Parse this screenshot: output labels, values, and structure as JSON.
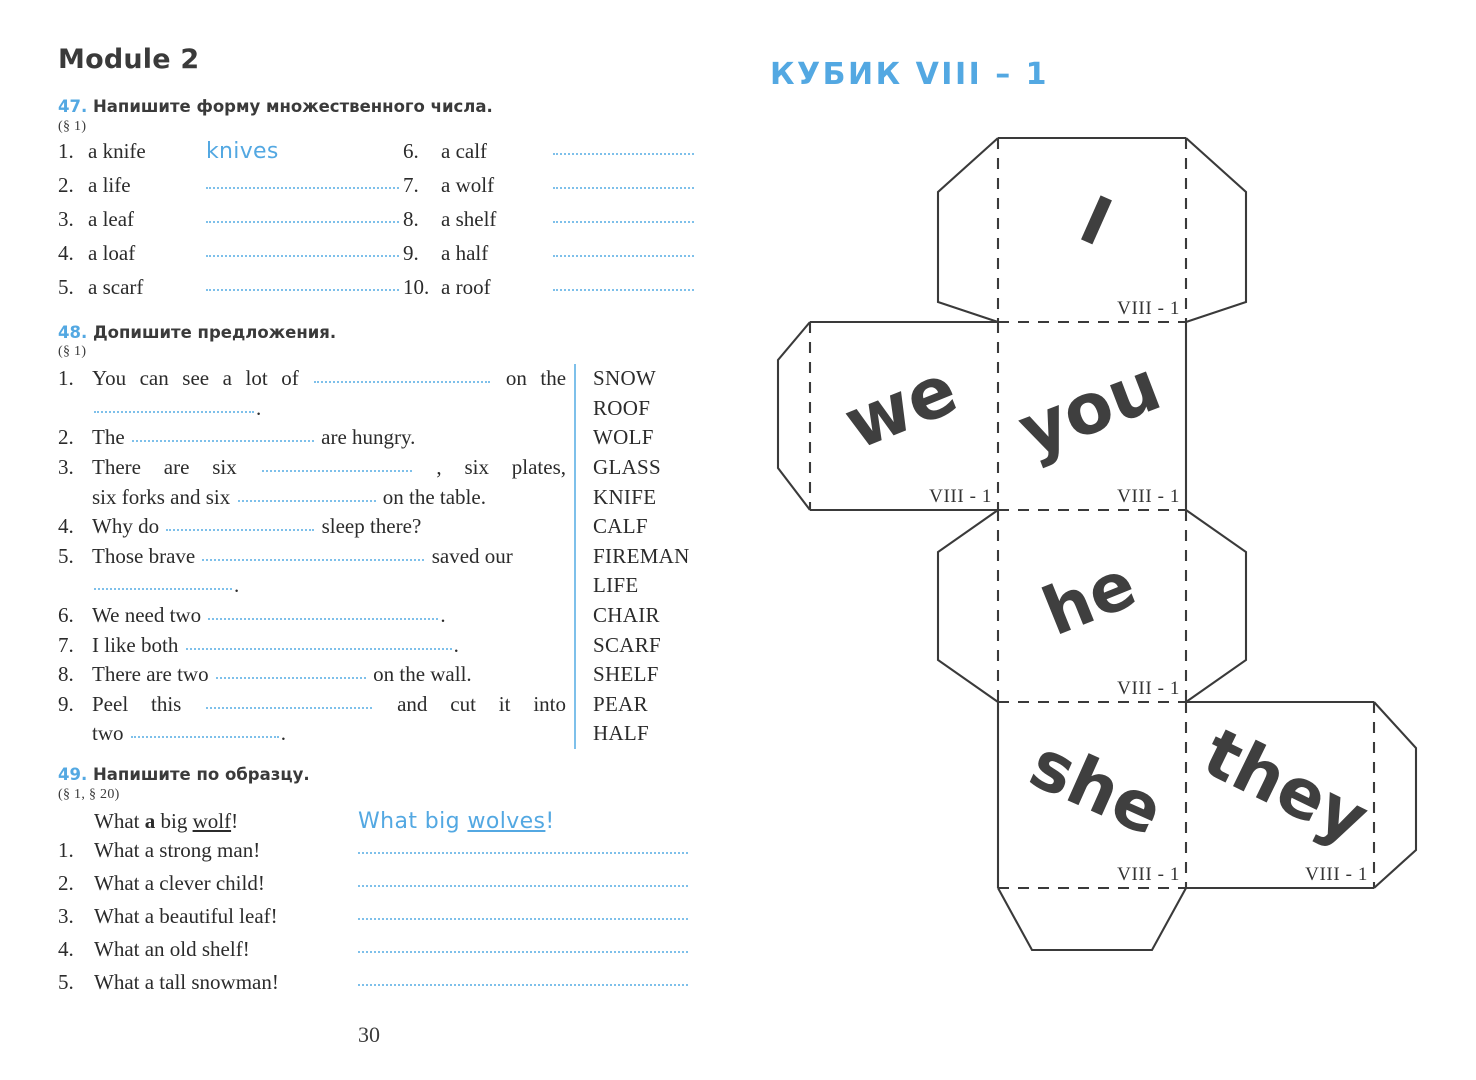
{
  "page": {
    "module_title": "Module 2",
    "page_number": "30"
  },
  "exercise47": {
    "number": "47.",
    "instruction": "Напишите форму множественного числа.",
    "reference": "(§ 1)",
    "column1": [
      {
        "index": "1.",
        "term": "a knife",
        "answer": "knives",
        "filled": true
      },
      {
        "index": "2.",
        "term": "a life",
        "answer": "",
        "filled": false
      },
      {
        "index": "3.",
        "term": "a leaf",
        "answer": "",
        "filled": false
      },
      {
        "index": "4.",
        "term": "a loaf",
        "answer": "",
        "filled": false
      },
      {
        "index": "5.",
        "term": "a scarf",
        "answer": "",
        "filled": false
      }
    ],
    "column2": [
      {
        "index": "6.",
        "term": "a calf",
        "answer": "",
        "filled": false
      },
      {
        "index": "7.",
        "term": "a wolf",
        "answer": "",
        "filled": false
      },
      {
        "index": "8.",
        "term": "a shelf",
        "answer": "",
        "filled": false
      },
      {
        "index": "9.",
        "term": "a half",
        "answer": "",
        "filled": false
      },
      {
        "index": "10.",
        "term": "a roof",
        "answer": "",
        "filled": false
      }
    ]
  },
  "exercise48": {
    "number": "48.",
    "instruction": "Допишите предложения.",
    "reference": "(§ 1)",
    "sentences": [
      {
        "index": "1.",
        "part1": "You can see a lot of",
        "part2": "on the",
        "part3": ".",
        "two_lines": true
      },
      {
        "index": "2.",
        "part1": "The",
        "part2": "are hungry.",
        "two_lines": false
      },
      {
        "index": "3.",
        "part1": "There are six",
        "part2": ", six plates,",
        "part3": "six forks and six",
        "part4": "on the table.",
        "two_lines": true
      },
      {
        "index": "4.",
        "part1": "Why do",
        "part2": "sleep there?",
        "two_lines": false
      },
      {
        "index": "5.",
        "part1": "Those brave",
        "part2": "saved our",
        "part3": ".",
        "two_lines": true
      },
      {
        "index": "6.",
        "part1": "We need two",
        "part2": ".",
        "two_lines": false
      },
      {
        "index": "7.",
        "part1": "I like both",
        "part2": ".",
        "two_lines": false
      },
      {
        "index": "8.",
        "part1": "There are two",
        "part2": "on the wall.",
        "two_lines": false
      },
      {
        "index": "9.",
        "part1": "Peel this",
        "part2": "and cut it into",
        "part3": "two",
        "part4": ".",
        "two_lines": true
      }
    ],
    "word_bank": [
      "SNOW",
      "ROOF",
      "WOLF",
      "GLASS",
      "KNIFE",
      "CALF",
      "FIREMAN",
      "LIFE",
      "CHAIR",
      "SCARF",
      "SHELF",
      "PEAR",
      "HALF"
    ]
  },
  "exercise49": {
    "number": "49.",
    "instruction": "Напишите по образцу.",
    "reference": "(§ 1,  § 20)",
    "sample_left_pre": "What ",
    "sample_left_bold": "a",
    "sample_left_mid": " big ",
    "sample_left_underline": "wolf",
    "sample_left_post": "!",
    "sample_right_pre": "What big ",
    "sample_right_underline": "wolves",
    "sample_right_post": "!",
    "items": [
      {
        "index": "1.",
        "phrase": "What a strong man!"
      },
      {
        "index": "2.",
        "phrase": "What a clever child!"
      },
      {
        "index": "3.",
        "phrase": "What a beautiful leaf!"
      },
      {
        "index": "4.",
        "phrase": "What an old shelf!"
      },
      {
        "index": "5.",
        "phrase": "What a tall snowman!"
      }
    ]
  },
  "cube": {
    "title": "КУБИК  VIII – 1",
    "face_code": "VIII - 1",
    "faces": [
      {
        "id": "i",
        "word": "I",
        "code": "VIII - 1"
      },
      {
        "id": "we",
        "word": "we",
        "code": "VIII - 1"
      },
      {
        "id": "you",
        "word": "you",
        "code": "VIII - 1"
      },
      {
        "id": "he",
        "word": "he",
        "code": "VIII - 1"
      },
      {
        "id": "she",
        "word": "she",
        "code": "VIII - 1"
      },
      {
        "id": "they",
        "word": "they",
        "code": "VIII - 1"
      }
    ]
  },
  "colors": {
    "accent_blue": "#53a8e2",
    "dotted_blue": "#7ec0ea",
    "ink": "#3a3a3a"
  }
}
